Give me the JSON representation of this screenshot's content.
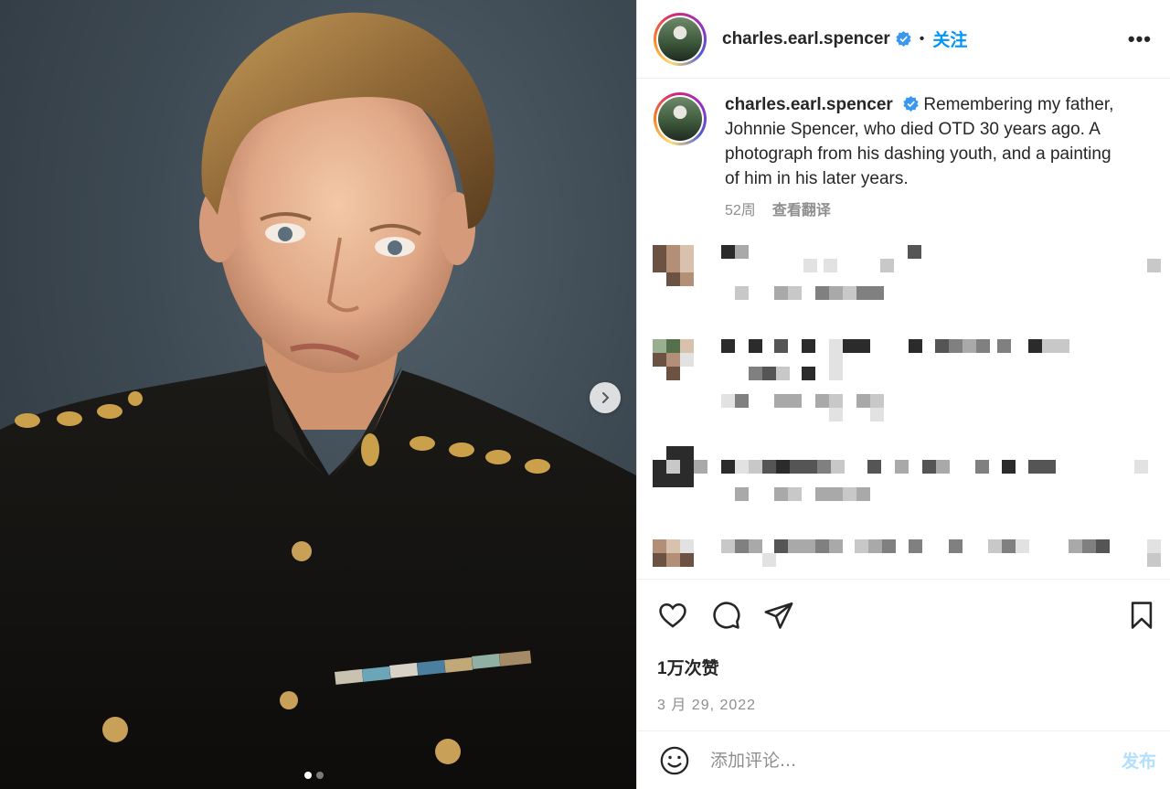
{
  "post": {
    "username": "charles.earl.spencer",
    "follow_label": "关注",
    "separator": "•",
    "more_label": "•••",
    "caption": "Remembering my father, Johnnie Spencer, who died OTD 30 years ago. A photograph from his dashing youth, and a painting of him in his later years.",
    "age": "52周",
    "translate_label": "查看翻译",
    "likes": "1万次赞",
    "date": "3 月 29, 2022",
    "comment_placeholder": "添加评论...",
    "post_label": "发布",
    "carousel": {
      "total": 2,
      "current": 1
    }
  },
  "colors": {
    "accent": "#0095f6",
    "post_disabled": "#b2dffc",
    "muted": "#8e8e8e",
    "verified": "#3897f0"
  },
  "icons": [
    "heart-icon",
    "comment-icon",
    "share-icon",
    "bookmark-icon",
    "emoji-icon",
    "chevron-right-icon",
    "verified-badge-icon",
    "more-options-icon"
  ]
}
